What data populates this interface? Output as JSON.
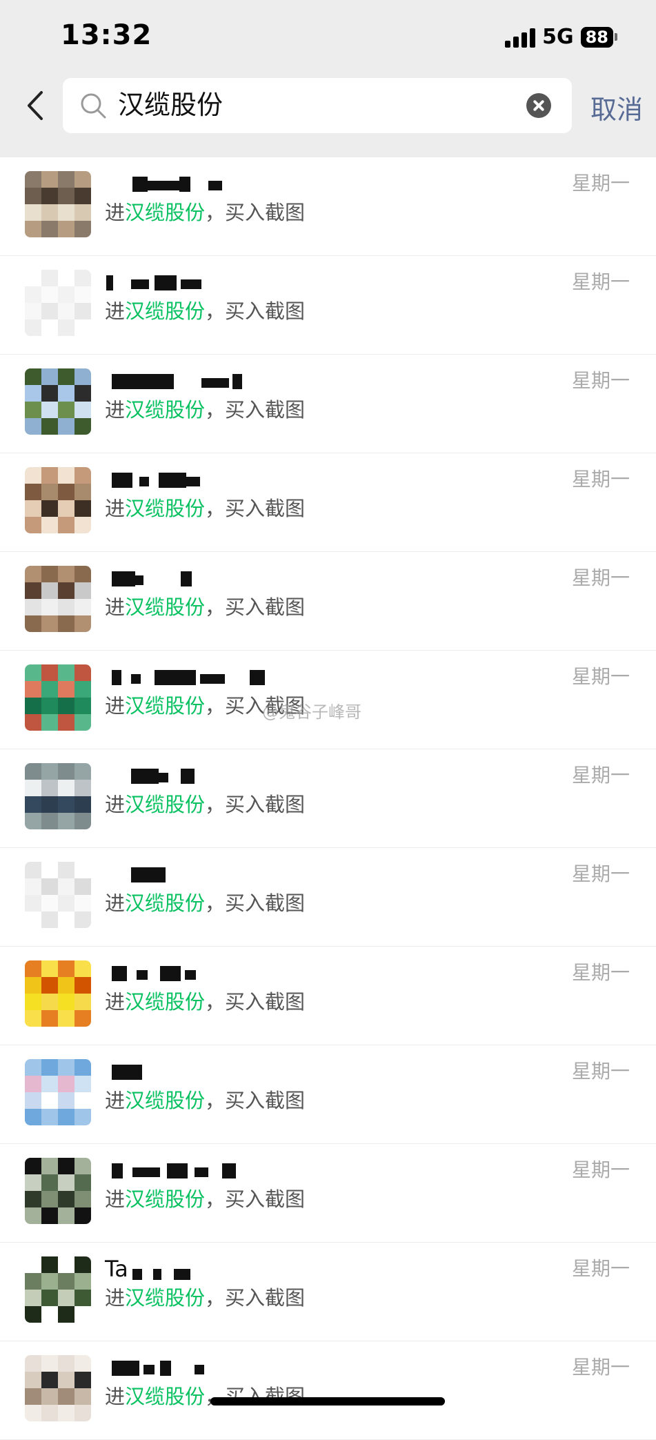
{
  "status_bar": {
    "time": "13:32",
    "network": "5G",
    "battery": "88"
  },
  "search": {
    "query": "汉缆股份",
    "cancel_label": "取消"
  },
  "results": [
    {
      "name": "Ta",
      "snippet_prefix": "进",
      "snippet_highlight": "汉缆股份",
      "snippet_suffix": "，买入截图",
      "date": "星期一"
    }
  ],
  "watermark": "@鬼谷子峰哥"
}
